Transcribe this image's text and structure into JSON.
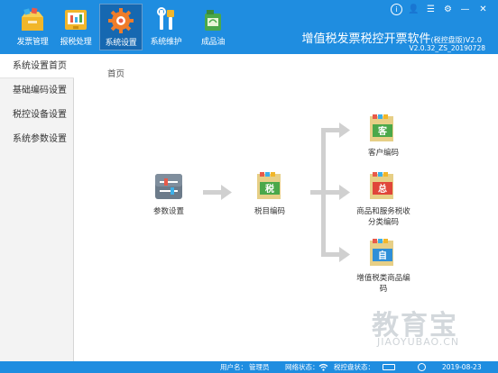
{
  "toolbar": {
    "items": [
      {
        "label": "发票管理",
        "icon": "invoice-box-icon"
      },
      {
        "label": "报税处理",
        "icon": "tax-report-icon"
      },
      {
        "label": "系统设置",
        "icon": "settings-gear-icon",
        "active": true
      },
      {
        "label": "系统维护",
        "icon": "maintenance-tools-icon"
      },
      {
        "label": "成品油",
        "icon": "oil-can-icon"
      }
    ]
  },
  "app": {
    "title": "增值税发票税控开票软件",
    "edition": "(税控盘版)",
    "version_suffix": "V2.0",
    "version": "V2.0.32_ZS_20190728"
  },
  "window_controls": {
    "info": "i",
    "user": "👤",
    "list": "☰",
    "settings": "⚙",
    "minimize": "—",
    "close": "✕"
  },
  "sidebar": {
    "items": [
      {
        "label": "系统设置首页",
        "active": true
      },
      {
        "label": "基础编码设置"
      },
      {
        "label": "税控设备设置"
      },
      {
        "label": "系统参数设置"
      }
    ]
  },
  "main": {
    "breadcrumb": "首页",
    "nodes": {
      "params": {
        "label": "参数设置",
        "icon": "params-sliders-icon"
      },
      "tax_code": {
        "label": "税目编码",
        "icon_char": "税",
        "icon_color": "#4aa84a"
      },
      "customer": {
        "label": "客户编码",
        "icon_char": "客",
        "icon_color": "#4aa84a"
      },
      "goods": {
        "label_line1": "商品和服务税收",
        "label_line2": "分类编码",
        "icon_char": "总",
        "icon_color": "#e0453a"
      },
      "vat_goods": {
        "label_line1": "增值税类商品编",
        "label_line2": "码",
        "icon_char": "自",
        "icon_color": "#2f8fd8"
      }
    },
    "watermark_cn": "教育宝",
    "watermark_en": "JIAOYUBAO.CN"
  },
  "status": {
    "user_label": "用户名：",
    "user": "管理员",
    "net_label": "网络状态：",
    "disk_label": "税控盘状态：",
    "date": "2019-08-23"
  },
  "colors": {
    "header": "#1f8de0",
    "arrow": "#d0d0d0"
  }
}
